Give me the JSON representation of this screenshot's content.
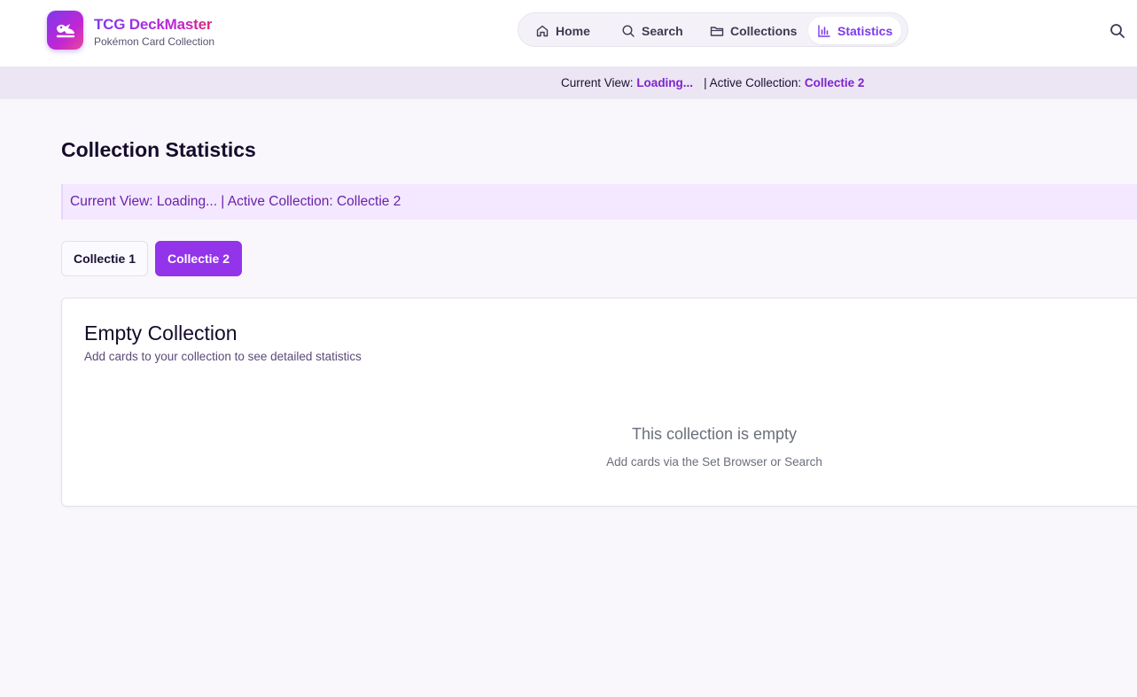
{
  "brand": {
    "title": "TCG DeckMaster",
    "subtitle": "Pokémon Card Collection",
    "logo_icon": "pokemon-logo-icon"
  },
  "nav": {
    "items": [
      {
        "label": "Home",
        "icon": "home-icon"
      },
      {
        "label": "Search",
        "icon": "search-icon"
      },
      {
        "label": "Collections",
        "icon": "folder-icon"
      },
      {
        "label": "Statistics",
        "icon": "bar-chart-icon",
        "active": true
      }
    ]
  },
  "status": {
    "current_view_label": "Current View:",
    "current_view_value": "Loading...",
    "active_collection_label": "| Active Collection:",
    "active_collection_value": "Collectie 2"
  },
  "page": {
    "title": "Collection Statistics",
    "info_text": "Current View: Loading... | Active Collection: Collectie 2"
  },
  "collections": {
    "buttons": [
      {
        "label": "Collectie 1",
        "active": false
      },
      {
        "label": "Collectie 2",
        "active": true
      }
    ]
  },
  "card": {
    "title": "Empty Collection",
    "subtitle": "Add cards to your collection to see detailed statistics",
    "empty_title": "This collection is empty",
    "empty_subtitle": "Add cards via the Set Browser or Search"
  },
  "colors": {
    "accent": "#7c3aed",
    "active_button": "#9333ea",
    "status_bar_bg": "#ece6f4",
    "info_bar_bg": "#f3e8ff"
  }
}
